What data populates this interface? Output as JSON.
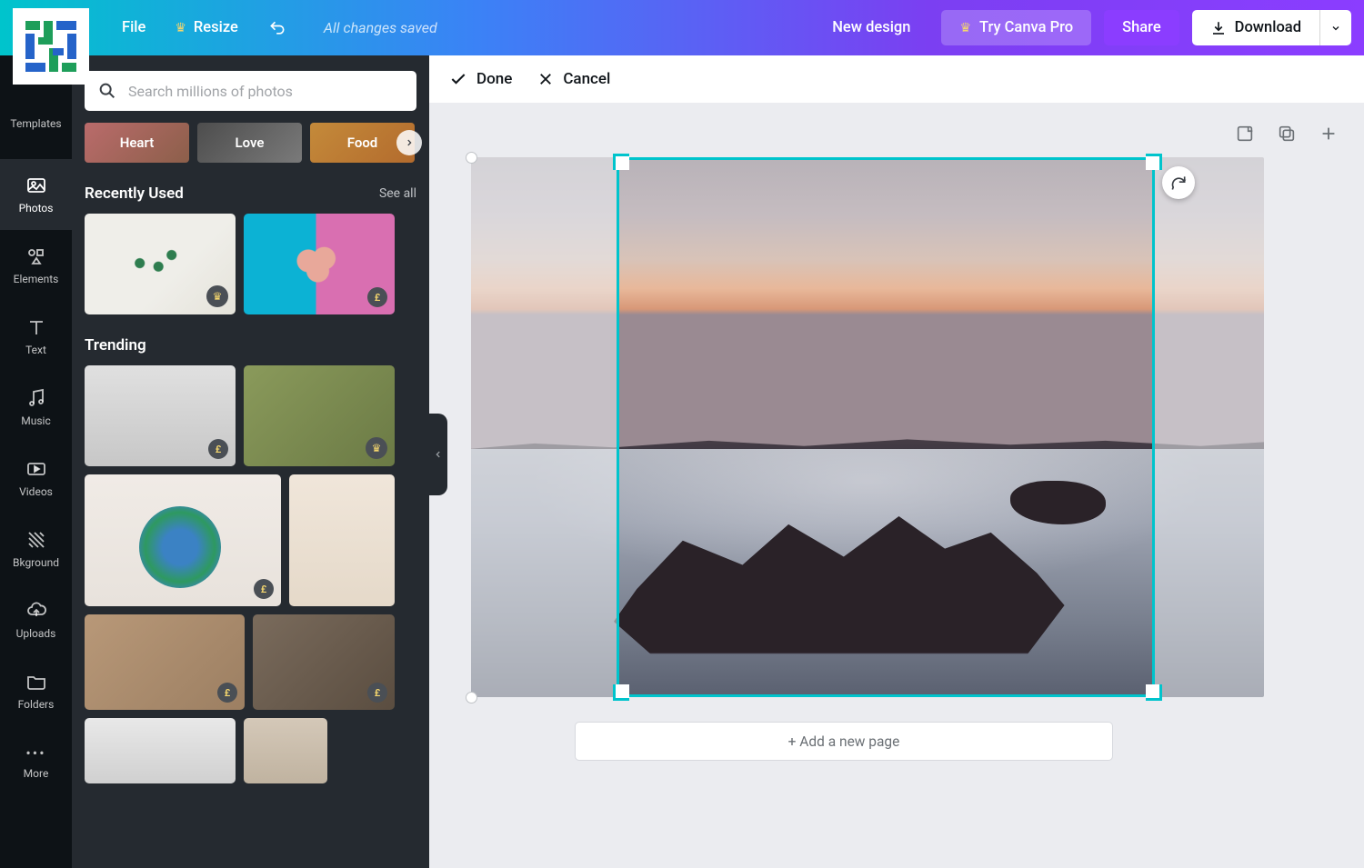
{
  "topbar": {
    "file": "File",
    "resize": "Resize",
    "status": "All changes saved",
    "new_design": "New design",
    "try_pro": "Try Canva Pro",
    "share": "Share",
    "download": "Download"
  },
  "actionbar": {
    "done": "Done",
    "cancel": "Cancel"
  },
  "rail": {
    "templates": "Templates",
    "photos": "Photos",
    "elements": "Elements",
    "text": "Text",
    "music": "Music",
    "videos": "Videos",
    "background": "Bkground",
    "uploads": "Uploads",
    "folders": "Folders",
    "more": "More"
  },
  "search": {
    "placeholder": "Search millions of photos"
  },
  "categories": {
    "heart": "Heart",
    "love": "Love",
    "food": "Food"
  },
  "sections": {
    "recently_used": {
      "title": "Recently Used",
      "see_all": "See all"
    },
    "trending": {
      "title": "Trending"
    }
  },
  "badges": {
    "pound": "£"
  },
  "canvas": {
    "add_page": "+ Add a new page"
  }
}
